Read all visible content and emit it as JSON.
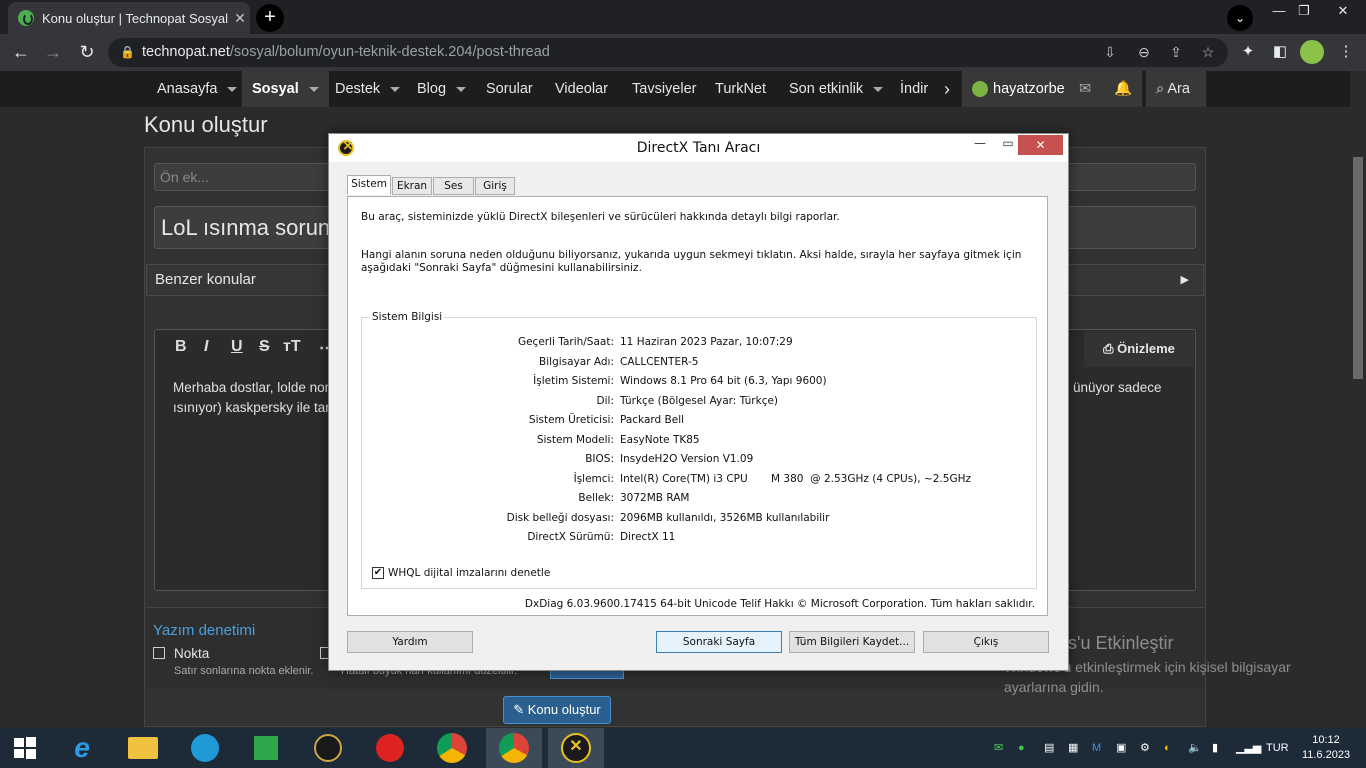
{
  "browser": {
    "tab_title": "Konu oluştur | Technopat Sosyal",
    "url_host": "technopat.net",
    "url_path": "/sosyal/bolum/oyun-teknik-destek.204/post-thread",
    "window_controls": {
      "minimize": "—",
      "maximize": "❐",
      "close": "✕"
    }
  },
  "sitenav": {
    "items": [
      {
        "label": "Anasayfa",
        "caret": true
      },
      {
        "label": "Sosyal",
        "caret": true
      },
      {
        "label": "Destek",
        "caret": true
      },
      {
        "label": "Blog",
        "caret": true
      },
      {
        "label": "Sorular",
        "caret": false
      },
      {
        "label": "Videolar",
        "caret": false
      },
      {
        "label": "Tavsiyeler",
        "caret": false
      },
      {
        "label": "TurkNet",
        "caret": false
      },
      {
        "label": "Son etkinlik",
        "caret": true
      },
      {
        "label": "İndir",
        "caret": false
      }
    ],
    "username": "hayatzorbe",
    "search_label": "Ara"
  },
  "page": {
    "title": "Konu oluştur",
    "prefix_placeholder": "Ön ek...",
    "thread_title": "LoL ısınma sorunu",
    "similar_threads": "Benzer konular",
    "editor_text_line1": "Merhaba dostlar, lolde nor",
    "editor_text_line1_right": "ünüyor sadece",
    "editor_text_line2": "ısınıyor) kaskpersky ile tara",
    "preview_label": "Önizleme",
    "spell_title": "Yazım denetimi",
    "spell_option": "Nokta",
    "spell_option_desc": "Satır sonlarına nokta eklenir.",
    "spell_option2_desc": "Hatalı büyük harf kullanımı düzeltilir.",
    "submit_label": "Konu oluştur"
  },
  "activation": {
    "title": "Windows'u Etkinleştir",
    "text": "Windows'u etkinleştirmek için kişisel bilgisayar ayarlarına gidin."
  },
  "dialog": {
    "title": "DirectX Tanı Aracı",
    "tabs": [
      "Sistem",
      "Ekran",
      "Ses",
      "Giriş"
    ],
    "intro": "Bu araç, sisteminizde yüklü DirectX bileşenleri ve sürücüleri hakkında detaylı bilgi raporlar.",
    "help": "Hangi alanın soruna neden olduğunu biliyorsanız, yukarıda uygun sekmeyi tıklatın.  Aksi halde, sırayla her sayfaya gitmek için aşağıdaki \"Sonraki Sayfa\" düğmesini kullanabilirsiniz.",
    "group_title": "Sistem Bilgisi",
    "rows": [
      {
        "k": "Geçerli Tarih/Saat:",
        "v": "11 Haziran 2023 Pazar, 10:07:29"
      },
      {
        "k": "Bilgisayar Adı:",
        "v": "CALLCENTER-5"
      },
      {
        "k": "İşletim Sistemi:",
        "v": "Windows 8.1 Pro 64 bit (6.3, Yapı 9600)"
      },
      {
        "k": "Dil:",
        "v": "Türkçe (Bölgesel Ayar: Türkçe)"
      },
      {
        "k": "Sistem Üreticisi:",
        "v": "Packard Bell"
      },
      {
        "k": "Sistem Modeli:",
        "v": "EasyNote TK85"
      },
      {
        "k": "BIOS:",
        "v": "InsydeH2O Version V1.09"
      },
      {
        "k": "İşlemci:",
        "v": "Intel(R) Core(TM) i3 CPU       M 380  @ 2.53GHz (4 CPUs), ~2.5GHz"
      },
      {
        "k": "Bellek:",
        "v": "3072MB RAM"
      },
      {
        "k": "Disk belleği dosyası:",
        "v": "2096MB kullanıldı, 3526MB kullanılabilir"
      },
      {
        "k": "DirectX Sürümü:",
        "v": "DirectX 11"
      }
    ],
    "whql_label": "WHQL dijital imzalarını denetle",
    "whql_checked": true,
    "footer": "DxDiag 6.03.9600.17415 64-bit Unicode  Telif Hakkı © Microsoft Corporation. Tüm hakları saklıdır.",
    "buttons": {
      "help": "Yardım",
      "next": "Sonraki Sayfa",
      "save": "Tüm Bilgileri Kaydet...",
      "exit": "Çıkış"
    }
  },
  "taskbar": {
    "language": "TUR",
    "time": "10:12",
    "date": "11.6.2023"
  }
}
